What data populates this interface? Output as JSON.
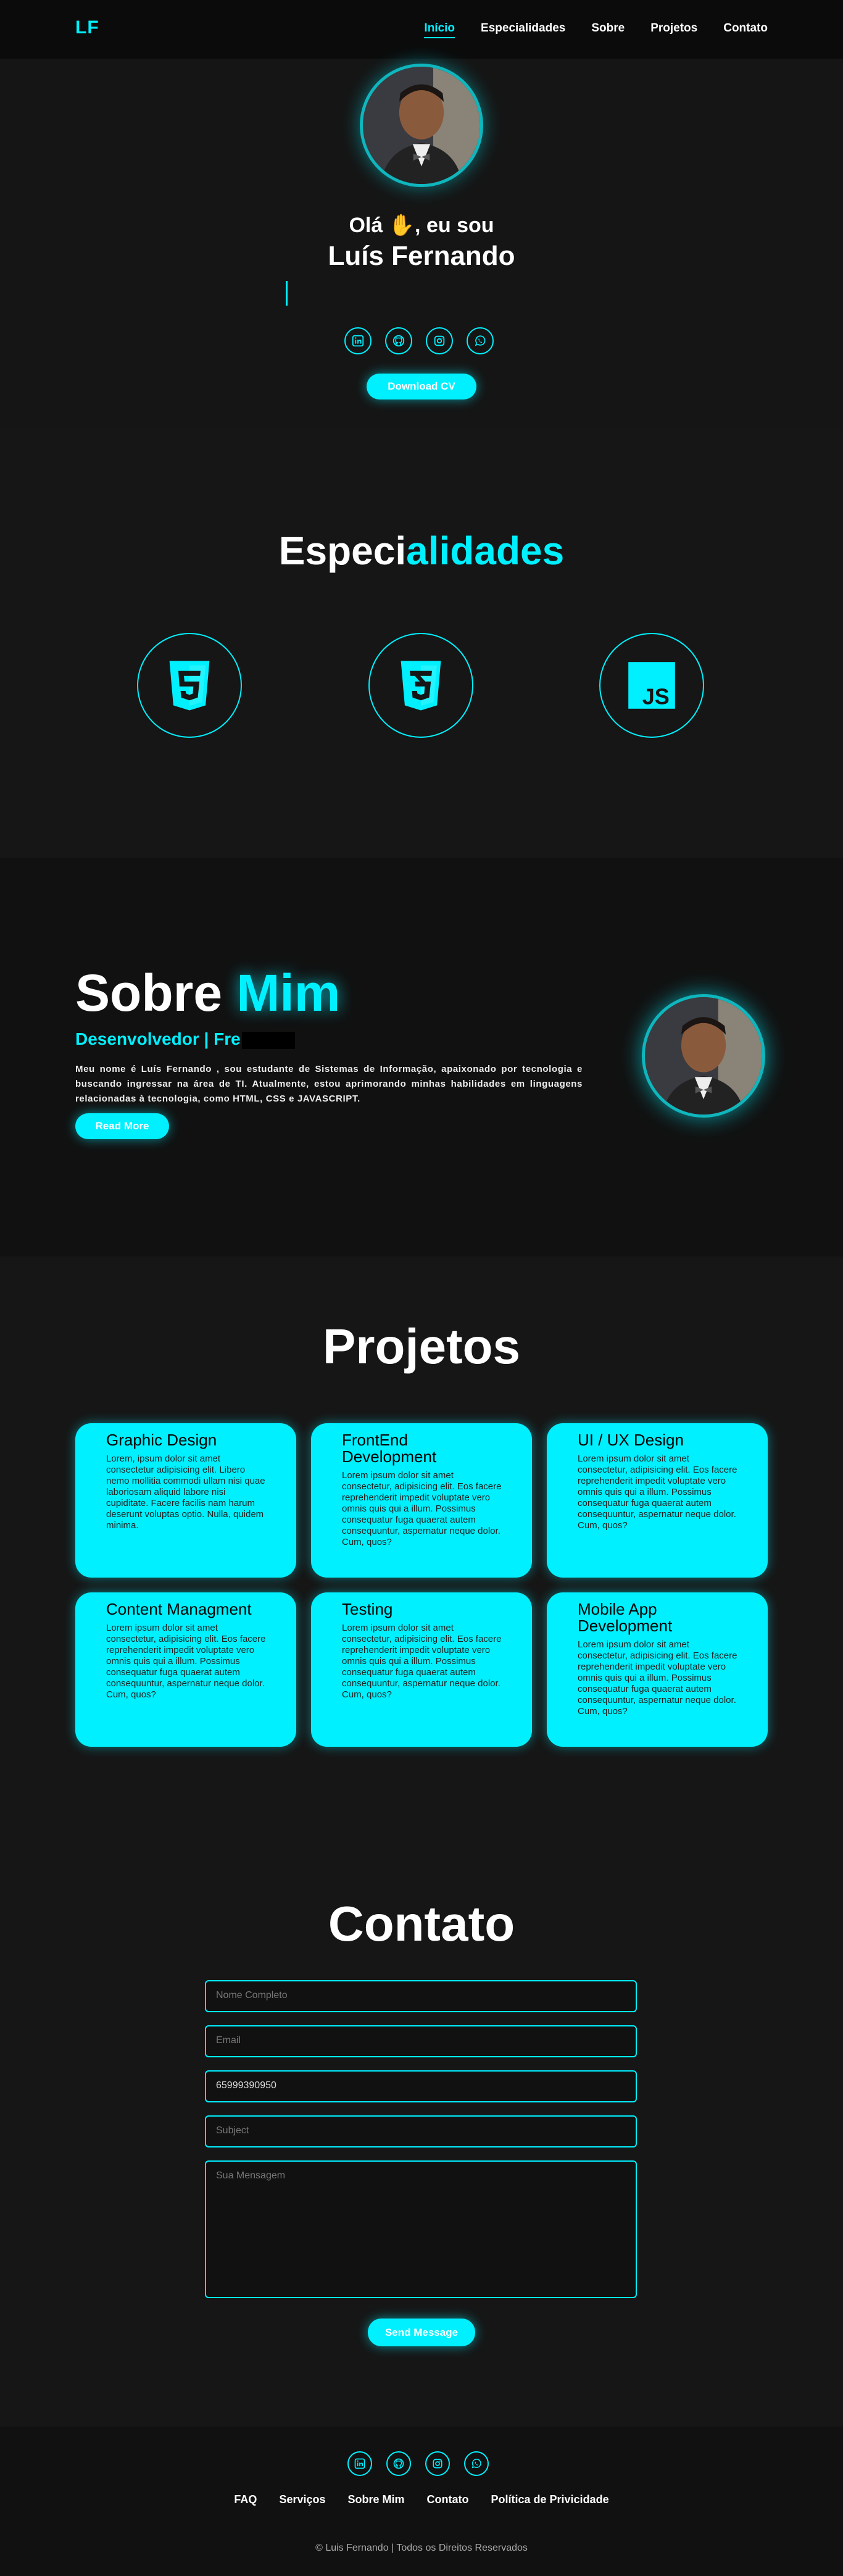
{
  "header": {
    "logo": "LF",
    "nav": [
      "Início",
      "Especialidades",
      "Sobre",
      "Projetos",
      "Contato"
    ],
    "active_index": 0
  },
  "hero": {
    "greeting": "Olá ✋, eu sou",
    "name": "Luís Fernando",
    "social_icons": [
      "linkedin-icon",
      "github-icon",
      "instagram-icon",
      "whatsapp-icon"
    ],
    "cv_button": "Download CV"
  },
  "especialidades": {
    "title_white": "Especi",
    "title_cyan": "alidades",
    "skills": [
      "html5-icon",
      "css3-icon",
      "javascript-icon"
    ]
  },
  "sobre": {
    "title_white": "Sobre ",
    "title_cyan": "Mim",
    "role": "Desenvolvedor | Fre",
    "bio": "Meu nome é Luís Fernando , sou estudante de Sistemas de Informação, apaixonado por tecnologia e buscando ingressar na área de TI. Atualmente, estou aprimorando minhas habilidades em linguagens relacionadas à tecnologia, como HTML, CSS e JAVASCRIPT.",
    "button": "Read More"
  },
  "projetos": {
    "title": "Projetos",
    "cards": [
      {
        "title": "Graphic Design",
        "text": "Lorem, ipsum dolor sit amet consectetur adipisicing elit. Libero nemo mollitia commodi ullam nisi quae laboriosam aliquid labore nisi cupiditate. Facere facilis nam harum deserunt voluptas optio. Nulla, quidem minima."
      },
      {
        "title": "FrontEnd Development",
        "text": "Lorem ipsum dolor sit amet consectetur, adipisicing elit. Eos facere reprehenderit impedit voluptate vero omnis quis qui a illum. Possimus consequatur fuga quaerat autem consequuntur, aspernatur neque dolor. Cum, quos?"
      },
      {
        "title": "UI / UX Design",
        "text": "Lorem ipsum dolor sit amet consectetur, adipisicing elit. Eos facere reprehenderit impedit voluptate vero omnis quis qui a illum. Possimus consequatur fuga quaerat autem consequuntur, aspernatur neque dolor. Cum, quos?"
      },
      {
        "title": "Content Managment",
        "text": "Lorem ipsum dolor sit amet consectetur, adipisicing elit. Eos facere reprehenderit impedit voluptate vero omnis quis qui a illum. Possimus consequatur fuga quaerat autem consequuntur, aspernatur neque dolor. Cum, quos?"
      },
      {
        "title": "Testing",
        "text": "Lorem ipsum dolor sit amet consectetur, adipisicing elit. Eos facere reprehenderit impedit voluptate vero omnis quis qui a illum. Possimus consequatur fuga quaerat autem consequuntur, aspernatur neque dolor. Cum, quos?"
      },
      {
        "title": "Mobile App Development",
        "text": "Lorem ipsum dolor sit amet consectetur, adipisicing elit. Eos facere reprehenderit impedit voluptate vero omnis quis qui a illum. Possimus consequatur fuga quaerat autem consequuntur, aspernatur neque dolor. Cum, quos?"
      }
    ]
  },
  "contato": {
    "title": "Contato",
    "name_placeholder": "Nome Completo",
    "email_placeholder": "Email",
    "phone_value": "65999390950",
    "subject_placeholder": "Subject",
    "message_placeholder": "Sua Mensagem",
    "send_button": "Send Message"
  },
  "footer": {
    "social_icons": [
      "linkedin-icon",
      "github-icon",
      "instagram-icon",
      "whatsapp-icon"
    ],
    "links": [
      "FAQ",
      "Serviços",
      "Sobre Mim",
      "Contato",
      "Política de Privicidade"
    ],
    "copyright": "© Luis Fernando | Todos os Direitos Reservados"
  },
  "colors": {
    "accent": "#00f0ff",
    "background": "#161616",
    "header": "#0b0b0b"
  }
}
